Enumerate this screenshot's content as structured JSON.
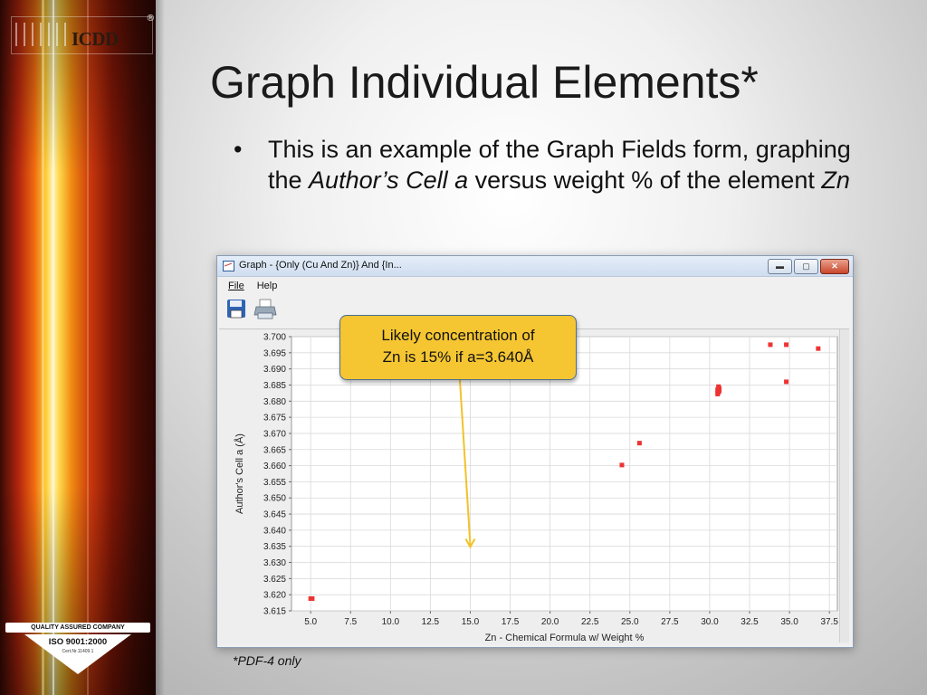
{
  "slide": {
    "title": "Graph Individual Elements*",
    "bullet_char": "•",
    "bullet_text": {
      "part1": "This is an example of the Graph Fields form, graphing the ",
      "italic1": "Author’s Cell a",
      "part2": " versus weight % of the element ",
      "italic2": "Zn"
    },
    "footnote": "*PDF-4 only",
    "callout": {
      "line1": "Likely concentration of",
      "line2": "Zn is 15% if a=3.640Å"
    },
    "logos": {
      "icdd_text": "ICDD",
      "registered": "®",
      "iso_header": "QUALITY ASSURED COMPANY",
      "iso_standard": "ISO 9001:2000",
      "iso_cert": "Cert.Nr.11409.1"
    }
  },
  "window": {
    "title": "Graph - {Only (Cu And Zn)} And {In...",
    "controls": [
      "▬",
      "▢",
      "✕"
    ],
    "menu": [
      "File",
      "Help"
    ],
    "toolbar": [
      "save-icon",
      "print-icon"
    ]
  },
  "chart_data": {
    "type": "scatter",
    "xlabel": "Zn - Chemical Formula w/ Weight %",
    "ylabel": "Author's Cell a (Å)",
    "xlim": [
      3.8,
      38.0
    ],
    "ylim": [
      3.615,
      3.7
    ],
    "x_ticks": [
      "5.0",
      "7.5",
      "10.0",
      "12.5",
      "15.0",
      "17.5",
      "20.0",
      "22.5",
      "25.0",
      "27.5",
      "30.0",
      "32.5",
      "35.0",
      "37.5"
    ],
    "y_ticks": [
      "3.615",
      "3.620",
      "3.625",
      "3.630",
      "3.635",
      "3.640",
      "3.645",
      "3.650",
      "3.655",
      "3.660",
      "3.665",
      "3.670",
      "3.675",
      "3.680",
      "3.685",
      "3.690",
      "3.695",
      "3.700"
    ],
    "grid": true,
    "marker_color": "#ee3333",
    "points": [
      {
        "x": 5.0,
        "y": 3.6188
      },
      {
        "x": 5.1,
        "y": 3.6188
      },
      {
        "x": 24.5,
        "y": 3.6602
      },
      {
        "x": 25.6,
        "y": 3.667
      },
      {
        "x": 30.5,
        "y": 3.6822
      },
      {
        "x": 30.55,
        "y": 3.6828
      },
      {
        "x": 30.6,
        "y": 3.6832
      },
      {
        "x": 30.5,
        "y": 3.6836
      },
      {
        "x": 30.6,
        "y": 3.684
      },
      {
        "x": 30.55,
        "y": 3.6845
      },
      {
        "x": 30.5,
        "y": 3.6828
      },
      {
        "x": 33.8,
        "y": 3.6975
      },
      {
        "x": 34.8,
        "y": 3.6975
      },
      {
        "x": 34.8,
        "y": 3.686
      },
      {
        "x": 36.8,
        "y": 3.6963
      }
    ],
    "annotation_point": {
      "x": 15.0,
      "y": 3.6345
    }
  }
}
